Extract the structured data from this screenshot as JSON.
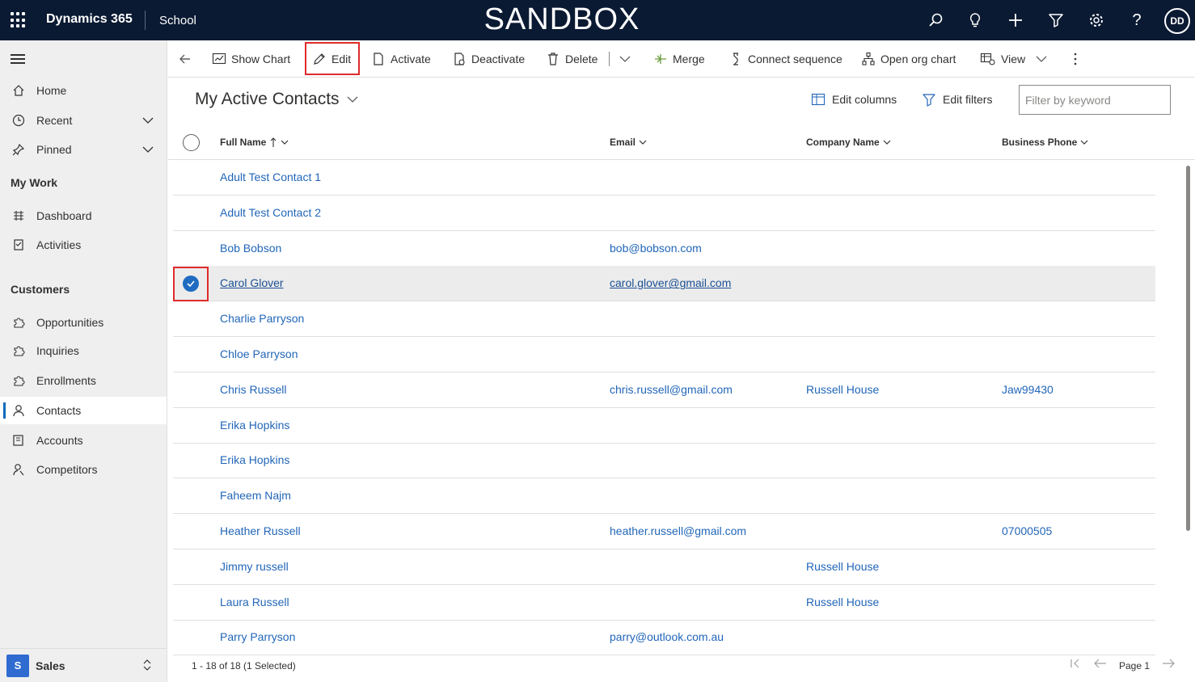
{
  "topbar": {
    "brand": "Dynamics 365",
    "app_name": "School",
    "env_label": "SANDBOX",
    "avatar_initials": "DD",
    "icons": [
      "search-icon",
      "lightbulb-icon",
      "plus-icon",
      "filter-icon",
      "gear-icon",
      "help-icon"
    ]
  },
  "sidebar": {
    "top_items": [
      {
        "label": "Home",
        "icon": "home-icon"
      },
      {
        "label": "Recent",
        "icon": "clock-icon"
      },
      {
        "label": "Pinned",
        "icon": "pin-icon"
      }
    ],
    "sections": [
      {
        "title": "My Work",
        "items": [
          {
            "label": "Dashboard",
            "icon": "dashboard-icon"
          },
          {
            "label": "Activities",
            "icon": "activities-icon"
          }
        ]
      },
      {
        "title": "Customers",
        "items": [
          {
            "label": "Opportunities",
            "icon": "puzzle-icon"
          },
          {
            "label": "Inquiries",
            "icon": "puzzle-icon"
          },
          {
            "label": "Enrollments",
            "icon": "puzzle-icon"
          },
          {
            "label": "Contacts",
            "icon": "person-icon",
            "active": true
          },
          {
            "label": "Accounts",
            "icon": "accounts-icon"
          },
          {
            "label": "Competitors",
            "icon": "competitor-icon"
          }
        ]
      }
    ],
    "area": {
      "initial": "S",
      "label": "Sales"
    }
  },
  "commandbar": {
    "show_chart": "Show Chart",
    "edit": "Edit",
    "activate": "Activate",
    "deactivate": "Deactivate",
    "delete": "Delete",
    "merge": "Merge",
    "connect_sequence": "Connect sequence",
    "open_org_chart": "Open org chart",
    "view": "View"
  },
  "view": {
    "title": "My Active Contacts",
    "edit_columns": "Edit columns",
    "edit_filters": "Edit filters",
    "filter_placeholder": "Filter by keyword"
  },
  "grid": {
    "columns": [
      "Full Name",
      "Email",
      "Company Name",
      "Business Phone"
    ],
    "rows": [
      {
        "name": "Adult Test Contact 1",
        "email": "",
        "company": "",
        "phone": ""
      },
      {
        "name": "Adult Test Contact 2",
        "email": "",
        "company": "",
        "phone": ""
      },
      {
        "name": "Bob Bobson",
        "email": "bob@bobson.com",
        "company": "",
        "phone": ""
      },
      {
        "name": "Carol Glover",
        "email": "carol.glover@gmail.com",
        "company": "",
        "phone": "",
        "selected": true
      },
      {
        "name": "Charlie Parryson",
        "email": "",
        "company": "",
        "phone": ""
      },
      {
        "name": "Chloe Parryson",
        "email": "",
        "company": "",
        "phone": ""
      },
      {
        "name": "Chris Russell",
        "email": "chris.russell@gmail.com",
        "company": "Russell House",
        "phone": "Jaw99430"
      },
      {
        "name": "Erika Hopkins",
        "email": "",
        "company": "",
        "phone": ""
      },
      {
        "name": "Erika Hopkins",
        "email": "",
        "company": "",
        "phone": ""
      },
      {
        "name": "Faheem Najm",
        "email": "",
        "company": "",
        "phone": ""
      },
      {
        "name": "Heather Russell",
        "email": "heather.russell@gmail.com",
        "company": "",
        "phone": "07000505"
      },
      {
        "name": "Jimmy russell",
        "email": "",
        "company": "Russell House",
        "phone": ""
      },
      {
        "name": "Laura Russell",
        "email": "",
        "company": "Russell House",
        "phone": ""
      },
      {
        "name": "Parry Parryson",
        "email": "parry@outlook.com.au",
        "company": "",
        "phone": ""
      }
    ],
    "footer": "1 - 18 of 18 (1 Selected)",
    "page_label": "Page 1"
  },
  "colors": {
    "topbar": "#0b1a33",
    "link": "#2266b8",
    "accent": "#0f6cbd",
    "highlight": "#e02b2b"
  }
}
